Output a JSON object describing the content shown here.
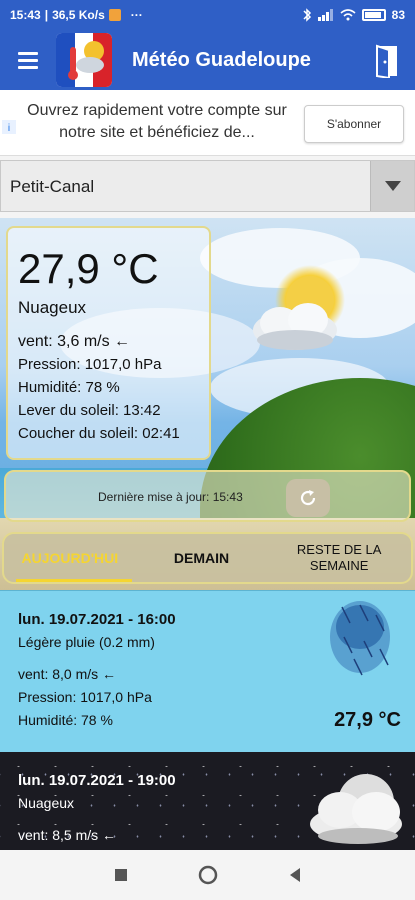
{
  "status_bar": {
    "time": "15:43",
    "speed": "36,5 Ko/s",
    "dots": "···",
    "battery": "83"
  },
  "app_bar": {
    "title": "Météo Guadeloupe"
  },
  "ad": {
    "text": "Ouvrez rapidement votre compte sur notre site et bénéficiez de...",
    "button_label": "S'abonner"
  },
  "location": {
    "selected": "Petit-Canal"
  },
  "current": {
    "temperature": "27,9 °C",
    "condition": "Nuageux",
    "wind": "vent: 3,6 m/s ←",
    "pressure": "Pression: 1017,0 hPa",
    "humidity": "Humidité: 78 %",
    "sunrise": "Lever du soleil: 13:42",
    "sunset": "Coucher du soleil: 02:41"
  },
  "update": {
    "text": "Dernière mise à jour: 15:43"
  },
  "tabs": [
    {
      "label": "AUJOURD'HUI",
      "active": true
    },
    {
      "label": "DEMAIN",
      "active": false
    },
    {
      "label": "RESTE DE LA SEMAINE",
      "active": false
    }
  ],
  "forecasts": [
    {
      "date": "lun. 19.07.2021 - 16:00",
      "condition": "Légère pluie (0.2 mm)",
      "wind": "vent: 8,0 m/s ←",
      "pressure": "Pression: 1017,0 hPa",
      "humidity": "Humidité: 78 %",
      "temperature": "27,9 °C",
      "icon": "rain-icon",
      "bg_color": "#7fd3ee"
    },
    {
      "date": "lun. 19.07.2021 - 19:00",
      "condition": "Nuageux",
      "wind": "vent: 8,5 m/s ←",
      "icon": "night-cloud-icon",
      "bg_color": "#1b1b22"
    }
  ],
  "colors": {
    "brand": "#2f5fc6",
    "tab_active": "#f5d531",
    "card_border": "#e3d98c"
  }
}
